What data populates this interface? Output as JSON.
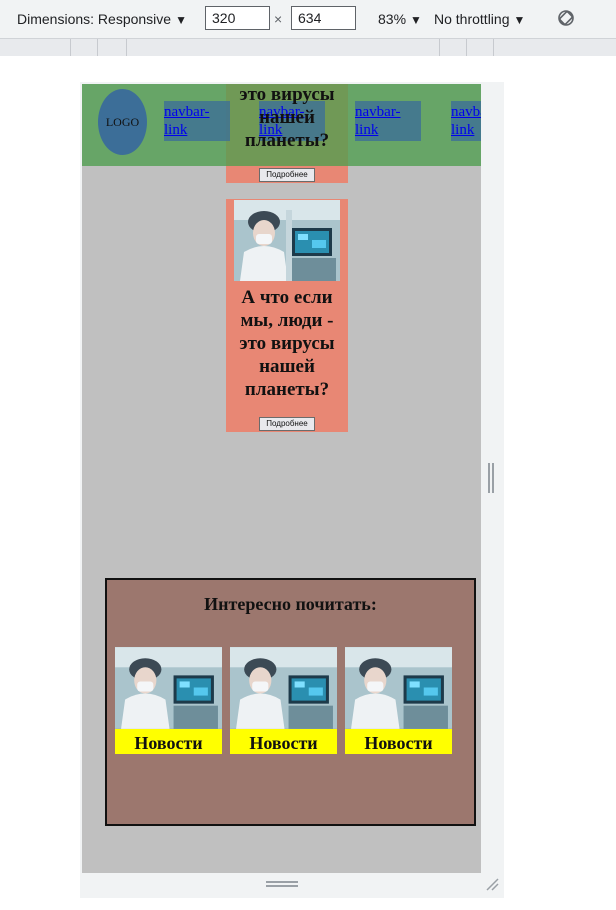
{
  "toolbar": {
    "dimensions_label": "Dimensions: Responsive",
    "width_value": "320",
    "times_symbol": "×",
    "height_value": "634",
    "zoom_label": "83%",
    "throttling_label": "No throttling"
  },
  "navbar": {
    "logo_text": "LOGO",
    "links": [
      "navbar-\nlink",
      "navbar-\nlink",
      "navbar-\nlink",
      "navbar-\nlink"
    ]
  },
  "hero": {
    "overlap_title": "это вирусы нашей планеты?",
    "button_label": "Подробнее"
  },
  "card": {
    "title": "А что если мы, люди - это вирусы нашей планеты?",
    "button_label": "Подробнее"
  },
  "reading": {
    "title": "Интересно почитать:",
    "items": [
      "Новости",
      "Новости",
      "Новости"
    ]
  },
  "colors": {
    "navbar": "#4e9e4e",
    "card": "#e88774",
    "section": "#9c776e",
    "news_label": "#ffff00",
    "logo": "#3c6e98",
    "viewport": "#c0c0c0"
  }
}
